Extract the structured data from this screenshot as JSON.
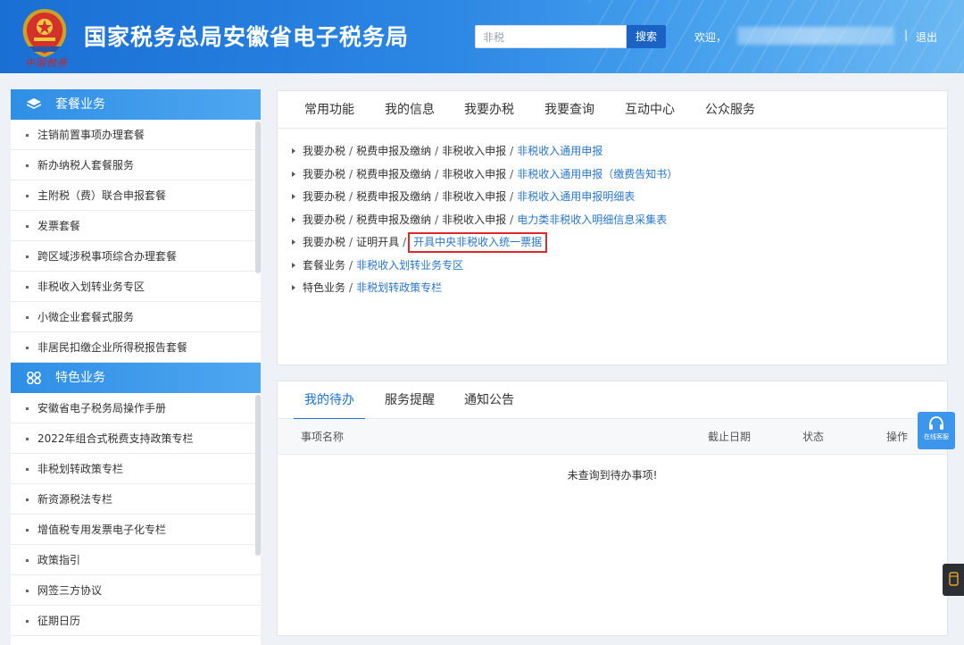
{
  "header": {
    "emblem_subtitle": "中国税务",
    "title": "国家税务总局安徽省电子税务局",
    "search_value": "非税",
    "search_button": "搜索",
    "welcome": "欢迎，",
    "separator": "|",
    "logout": "退出"
  },
  "sidebar": {
    "sections": [
      {
        "title": "套餐业务",
        "icon": "layers-icon",
        "items": [
          "注销前置事项办理套餐",
          "新办纳税人套餐服务",
          "主附税（费）联合申报套餐",
          "发票套餐",
          "跨区域涉税事项综合办理套餐",
          "非税收入划转业务专区",
          "小微企业套餐式服务",
          "非居民扣缴企业所得税报告套餐"
        ]
      },
      {
        "title": "特色业务",
        "icon": "grid-icon",
        "items": [
          "安徽省电子税务局操作手册",
          "2022年组合式税费支持政策专栏",
          "非税划转政策专栏",
          "新资源税法专栏",
          "增值税专用发票电子化专栏",
          "政策指引",
          "网签三方协议",
          "征期日历"
        ]
      }
    ]
  },
  "top_panel": {
    "tabs": [
      "常用功能",
      "我的信息",
      "我要办税",
      "我要查询",
      "互动中心",
      "公众服务"
    ],
    "links": [
      {
        "path": [
          "我要办税",
          "税费申报及缴纳",
          "非税收入申报"
        ],
        "target": "非税收入通用申报"
      },
      {
        "path": [
          "我要办税",
          "税费申报及缴纳",
          "非税收入申报"
        ],
        "target": "非税收入通用申报（缴费告知书）"
      },
      {
        "path": [
          "我要办税",
          "税费申报及缴纳",
          "非税收入申报"
        ],
        "target": "非税收入通用申报明细表"
      },
      {
        "path": [
          "我要办税",
          "税费申报及缴纳",
          "非税收入申报"
        ],
        "target": "电力类非税收入明细信息采集表"
      },
      {
        "path": [
          "我要办税",
          "证明开具"
        ],
        "target": "开具中央非税收入统一票据"
      },
      {
        "path": [
          "套餐业务"
        ],
        "target": "非税收入划转业务专区"
      },
      {
        "path": [
          "特色业务"
        ],
        "target": "非税划转政策专栏"
      }
    ]
  },
  "bottom_panel": {
    "tabs": [
      "我的待办",
      "服务提醒",
      "通知公告"
    ],
    "columns": [
      "事项名称",
      "截止日期",
      "状态",
      "操作"
    ],
    "empty_message": "未查询到待办事项!"
  },
  "float": {
    "kefu_label": "在线客服"
  },
  "colors": {
    "header_blue": "#1a6fd3",
    "link_blue": "#2a77c9",
    "highlight_red": "#e02a2a"
  }
}
